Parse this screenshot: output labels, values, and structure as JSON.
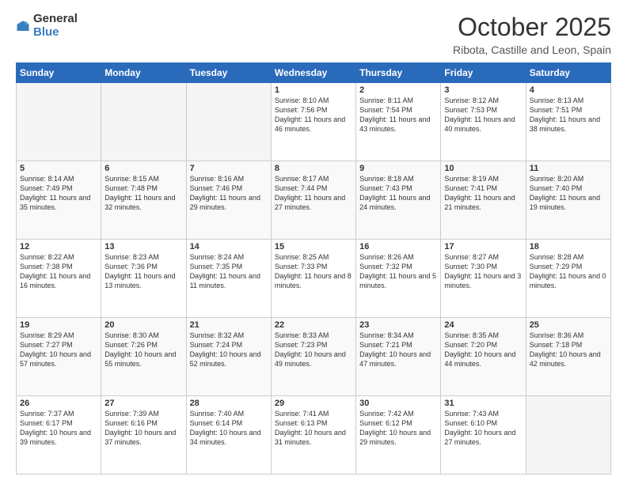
{
  "logo": {
    "general": "General",
    "blue": "Blue"
  },
  "header": {
    "month": "October 2025",
    "location": "Ribota, Castille and Leon, Spain"
  },
  "weekdays": [
    "Sunday",
    "Monday",
    "Tuesday",
    "Wednesday",
    "Thursday",
    "Friday",
    "Saturday"
  ],
  "weeks": [
    [
      {
        "day": "",
        "empty": true
      },
      {
        "day": "",
        "empty": true
      },
      {
        "day": "",
        "empty": true
      },
      {
        "day": "1",
        "sunrise": "8:10 AM",
        "sunset": "7:56 PM",
        "daylight": "11 hours and 46 minutes."
      },
      {
        "day": "2",
        "sunrise": "8:11 AM",
        "sunset": "7:54 PM",
        "daylight": "11 hours and 43 minutes."
      },
      {
        "day": "3",
        "sunrise": "8:12 AM",
        "sunset": "7:53 PM",
        "daylight": "11 hours and 40 minutes."
      },
      {
        "day": "4",
        "sunrise": "8:13 AM",
        "sunset": "7:51 PM",
        "daylight": "11 hours and 38 minutes."
      }
    ],
    [
      {
        "day": "5",
        "sunrise": "8:14 AM",
        "sunset": "7:49 PM",
        "daylight": "11 hours and 35 minutes."
      },
      {
        "day": "6",
        "sunrise": "8:15 AM",
        "sunset": "7:48 PM",
        "daylight": "11 hours and 32 minutes."
      },
      {
        "day": "7",
        "sunrise": "8:16 AM",
        "sunset": "7:46 PM",
        "daylight": "11 hours and 29 minutes."
      },
      {
        "day": "8",
        "sunrise": "8:17 AM",
        "sunset": "7:44 PM",
        "daylight": "11 hours and 27 minutes."
      },
      {
        "day": "9",
        "sunrise": "8:18 AM",
        "sunset": "7:43 PM",
        "daylight": "11 hours and 24 minutes."
      },
      {
        "day": "10",
        "sunrise": "8:19 AM",
        "sunset": "7:41 PM",
        "daylight": "11 hours and 21 minutes."
      },
      {
        "day": "11",
        "sunrise": "8:20 AM",
        "sunset": "7:40 PM",
        "daylight": "11 hours and 19 minutes."
      }
    ],
    [
      {
        "day": "12",
        "sunrise": "8:22 AM",
        "sunset": "7:38 PM",
        "daylight": "11 hours and 16 minutes."
      },
      {
        "day": "13",
        "sunrise": "8:23 AM",
        "sunset": "7:36 PM",
        "daylight": "11 hours and 13 minutes."
      },
      {
        "day": "14",
        "sunrise": "8:24 AM",
        "sunset": "7:35 PM",
        "daylight": "11 hours and 11 minutes."
      },
      {
        "day": "15",
        "sunrise": "8:25 AM",
        "sunset": "7:33 PM",
        "daylight": "11 hours and 8 minutes."
      },
      {
        "day": "16",
        "sunrise": "8:26 AM",
        "sunset": "7:32 PM",
        "daylight": "11 hours and 5 minutes."
      },
      {
        "day": "17",
        "sunrise": "8:27 AM",
        "sunset": "7:30 PM",
        "daylight": "11 hours and 3 minutes."
      },
      {
        "day": "18",
        "sunrise": "8:28 AM",
        "sunset": "7:29 PM",
        "daylight": "11 hours and 0 minutes."
      }
    ],
    [
      {
        "day": "19",
        "sunrise": "8:29 AM",
        "sunset": "7:27 PM",
        "daylight": "10 hours and 57 minutes."
      },
      {
        "day": "20",
        "sunrise": "8:30 AM",
        "sunset": "7:26 PM",
        "daylight": "10 hours and 55 minutes."
      },
      {
        "day": "21",
        "sunrise": "8:32 AM",
        "sunset": "7:24 PM",
        "daylight": "10 hours and 52 minutes."
      },
      {
        "day": "22",
        "sunrise": "8:33 AM",
        "sunset": "7:23 PM",
        "daylight": "10 hours and 49 minutes."
      },
      {
        "day": "23",
        "sunrise": "8:34 AM",
        "sunset": "7:21 PM",
        "daylight": "10 hours and 47 minutes."
      },
      {
        "day": "24",
        "sunrise": "8:35 AM",
        "sunset": "7:20 PM",
        "daylight": "10 hours and 44 minutes."
      },
      {
        "day": "25",
        "sunrise": "8:36 AM",
        "sunset": "7:18 PM",
        "daylight": "10 hours and 42 minutes."
      }
    ],
    [
      {
        "day": "26",
        "sunrise": "7:37 AM",
        "sunset": "6:17 PM",
        "daylight": "10 hours and 39 minutes."
      },
      {
        "day": "27",
        "sunrise": "7:39 AM",
        "sunset": "6:16 PM",
        "daylight": "10 hours and 37 minutes."
      },
      {
        "day": "28",
        "sunrise": "7:40 AM",
        "sunset": "6:14 PM",
        "daylight": "10 hours and 34 minutes."
      },
      {
        "day": "29",
        "sunrise": "7:41 AM",
        "sunset": "6:13 PM",
        "daylight": "10 hours and 31 minutes."
      },
      {
        "day": "30",
        "sunrise": "7:42 AM",
        "sunset": "6:12 PM",
        "daylight": "10 hours and 29 minutes."
      },
      {
        "day": "31",
        "sunrise": "7:43 AM",
        "sunset": "6:10 PM",
        "daylight": "10 hours and 27 minutes."
      },
      {
        "day": "",
        "empty": true
      }
    ]
  ]
}
